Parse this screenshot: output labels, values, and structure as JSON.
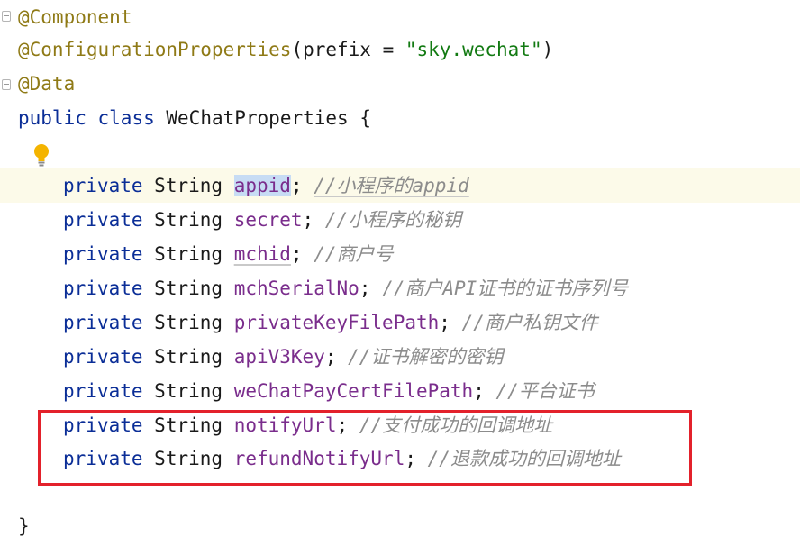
{
  "editor": {
    "annotations": {
      "component": "@Component",
      "config_name": "@ConfigurationProperties",
      "config_open": "(prefix = ",
      "config_value": "\"sky.wechat\"",
      "config_close": ")",
      "data": "@Data"
    },
    "class_decl": {
      "keyword_public": "public",
      "keyword_class": "class",
      "class_name": "WeChatProperties",
      "brace_open": "{"
    },
    "fields": [
      {
        "modifier": "private",
        "type": "String",
        "name": "appid",
        "semicolon": ";",
        "comment": "//小程序的appid"
      },
      {
        "modifier": "private",
        "type": "String",
        "name": "secret",
        "semicolon": ";",
        "comment": "//小程序的秘钥"
      },
      {
        "modifier": "private",
        "type": "String",
        "name": "mchid",
        "semicolon": ";",
        "comment": "//商户号"
      },
      {
        "modifier": "private",
        "type": "String",
        "name": "mchSerialNo",
        "semicolon": ";",
        "comment": "//商户API证书的证书序列号"
      },
      {
        "modifier": "private",
        "type": "String",
        "name": "privateKeyFilePath",
        "semicolon": ";",
        "comment": "//商户私钥文件"
      },
      {
        "modifier": "private",
        "type": "String",
        "name": "apiV3Key",
        "semicolon": ";",
        "comment": "//证书解密的密钥"
      },
      {
        "modifier": "private",
        "type": "String",
        "name": "weChatPayCertFilePath",
        "semicolon": ";",
        "comment": "//平台证书"
      },
      {
        "modifier": "private",
        "type": "String",
        "name": "notifyUrl",
        "semicolon": ";",
        "comment": "//支付成功的回调地址"
      },
      {
        "modifier": "private",
        "type": "String",
        "name": "refundNotifyUrl",
        "semicolon": ";",
        "comment": "//退款成功的回调地址"
      }
    ],
    "brace_close": "}",
    "colors": {
      "highlight_box": "#e3212b",
      "current_line": "#fcfae9",
      "selection": "#c7dcf4"
    },
    "icons": {
      "intention": "lightbulb-icon",
      "fold": "fold-marker-icon"
    }
  }
}
